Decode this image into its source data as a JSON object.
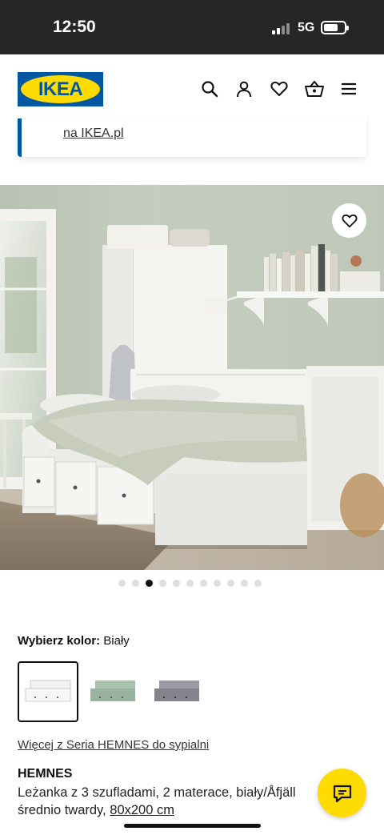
{
  "status_bar": {
    "time": "12:50",
    "network": "5G"
  },
  "header": {
    "logo_text": "IKEA",
    "icons": [
      "search-icon",
      "profile-icon",
      "heart-icon",
      "basket-icon",
      "menu-icon"
    ]
  },
  "notice": {
    "link_text": "na IKEA.pl"
  },
  "gallery": {
    "image_count": 11,
    "active_index": 2
  },
  "color_picker": {
    "label": "Wybierz kolor:",
    "selected": "Biały",
    "options": [
      {
        "name": "white",
        "color": "#f2f2f2"
      },
      {
        "name": "green",
        "color": "#9fbaa6"
      },
      {
        "name": "grey",
        "color": "#8c8c94"
      }
    ]
  },
  "product": {
    "series_link": "Więcej z Seria HEMNES do sypialni",
    "name": "HEMNES",
    "desc_line1": "Leżanka z 3 szufladami, 2 materace, biały/Åfjäll",
    "desc_line2": "średnio twardy,",
    "size": "80x200 cm"
  },
  "colors": {
    "ikea_blue": "#0058a3",
    "ikea_yellow": "#ffdb00"
  }
}
